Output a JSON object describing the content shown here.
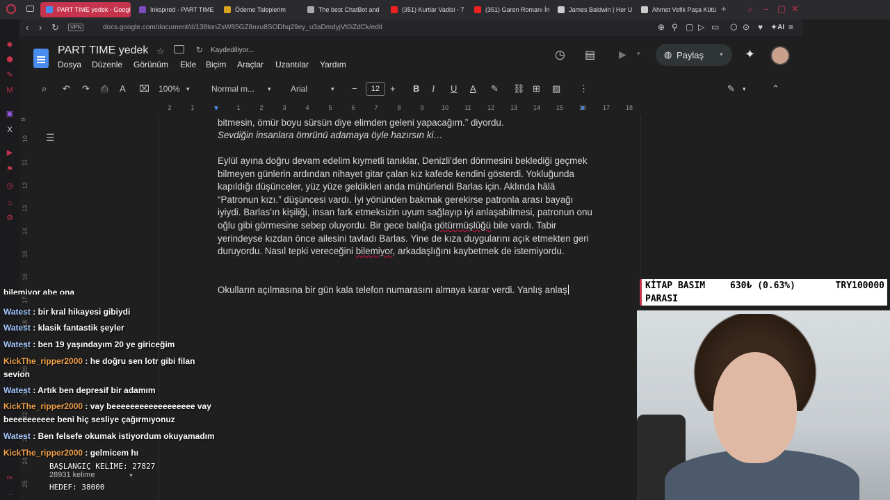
{
  "browser": {
    "tabs": [
      {
        "label": "PART TIME yedek - Google",
        "active": true
      },
      {
        "label": "Inkspired - PART TIME"
      },
      {
        "label": "Ödeme Taleplerim"
      },
      {
        "label": "The best ChatBot and"
      },
      {
        "label": "(351) Kurtlar Vadisi - 7"
      },
      {
        "label": "(351) Garen Romanı İn"
      },
      {
        "label": "James Baldwin | Her U"
      },
      {
        "label": "Ahmet Vefik Paşa Kütü"
      }
    ],
    "url": "docs.google.com/document/d/138tonZsW85GZ8nxu8SODhq29ey_u3aDmdyjVt0iZdCk/edit",
    "vpn_label": "VPN",
    "ai_label": "AI"
  },
  "docs": {
    "title": "PART TIME  yedek",
    "status": "Kaydediliyor...",
    "menus": [
      "Dosya",
      "Düzenle",
      "Görünüm",
      "Ekle",
      "Biçim",
      "Araçlar",
      "Uzantılar",
      "Yardım"
    ],
    "share_label": "Paylaş",
    "toolbar": {
      "zoom": "100%",
      "style": "Normal m...",
      "font": "Arial",
      "font_size": "12"
    },
    "ruler_numbers": [
      "2",
      "1",
      "1",
      "2",
      "3",
      "4",
      "5",
      "6",
      "7",
      "8",
      "9",
      "10",
      "11",
      "12",
      "13",
      "14",
      "15",
      "16",
      "17",
      "18"
    ],
    "vruler_numbers": [
      "9",
      "10",
      "11",
      "12",
      "13",
      "14",
      "15",
      "16",
      "17",
      "18",
      "19",
      "20",
      "21",
      "22",
      "23",
      "24",
      "25"
    ],
    "paragraphs": {
      "p0a": "bitmesin, ömür boyu sürsün diye elimden geleni yapacağım.” diyordu.",
      "p0b": "Sevdiğin insanlara ömrünü adamaya öyle hazırsın ki…",
      "p1_part1": "Eylül ayına doğru devam edelim kıymetli tanıklar, Denizli’den dönmesini beklediği geçmek bilmeyen günlerin ardından nihayet gitar çalan kız kafede kendini gösterdi. Yokluğunda kapıldığı düşünceler, yüz yüze geldikleri anda mühürlendi Barlas için. Aklında hâlâ “Patronun kızı.” düşüncesi vardı. İyi yönünden bakmak gerekirse patronla arası bayağı iyiydi. Barlas’ın kişiliği, insan fark etmeksizin uyum sağlayıp iyi anlaşabilmesi, patronun onu oğlu gibi görmesine sebep oluyordu. Bir gece balığa ",
      "p1_squig1": "götürmüşlüğü",
      "p1_part2": " bile vardı. Tabir yerindeyse kızdan önce ailesini tavladı Barlas. Yine de kıza duygularını açık etmekten geri duruyordu. Nasıl tepki vereceğini ",
      "p1_squig2": "bilemiyor",
      "p1_part3": ", arkadaşlığını kaybetmek de istemiyordu.",
      "p2": "Okulların açılmasına bir gün kala telefon numarasını almaya karar verdi. Yanlış anlaş"
    }
  },
  "chat": {
    "partial_top": "bilemiyor abe ona",
    "messages": [
      {
        "user": "Watest",
        "text": " : bir kral hikayesi gibiydi"
      },
      {
        "user": "Watest",
        "text": " : klasik fantastik şeyler"
      },
      {
        "user": "Watest",
        "text": " : ben 19 yaşındayım 20 ye giriceğim"
      },
      {
        "user": "KickThe_ripper2000",
        "text": " : he doğru sen lotr gibi filan sevion"
      },
      {
        "user": "Watest",
        "text": " : Artık ben depresif bir adamım"
      },
      {
        "user": "KickThe_ripper2000",
        "text": " : vay beeeeeeeeeeeeeeeeee vay beeeeeeeeee beni hiç sesliye çağırmıyonuz"
      },
      {
        "user": "Watest",
        "text": " : Ben felsefe okumak istiyordum okuyamadım"
      },
      {
        "user": "KickThe_ripper2000",
        "text": " : gelmicem hı"
      }
    ]
  },
  "wordcount": {
    "start": "BAŞLANGIÇ KELİME: 27827",
    "current": "28931 kelime",
    "goal": "HEDEF: 38000"
  },
  "donation": {
    "label1": "KİTAP BASIM",
    "label2": "PARASI",
    "amount": "630₺ (0.63%)",
    "goal": "TRY100000"
  }
}
